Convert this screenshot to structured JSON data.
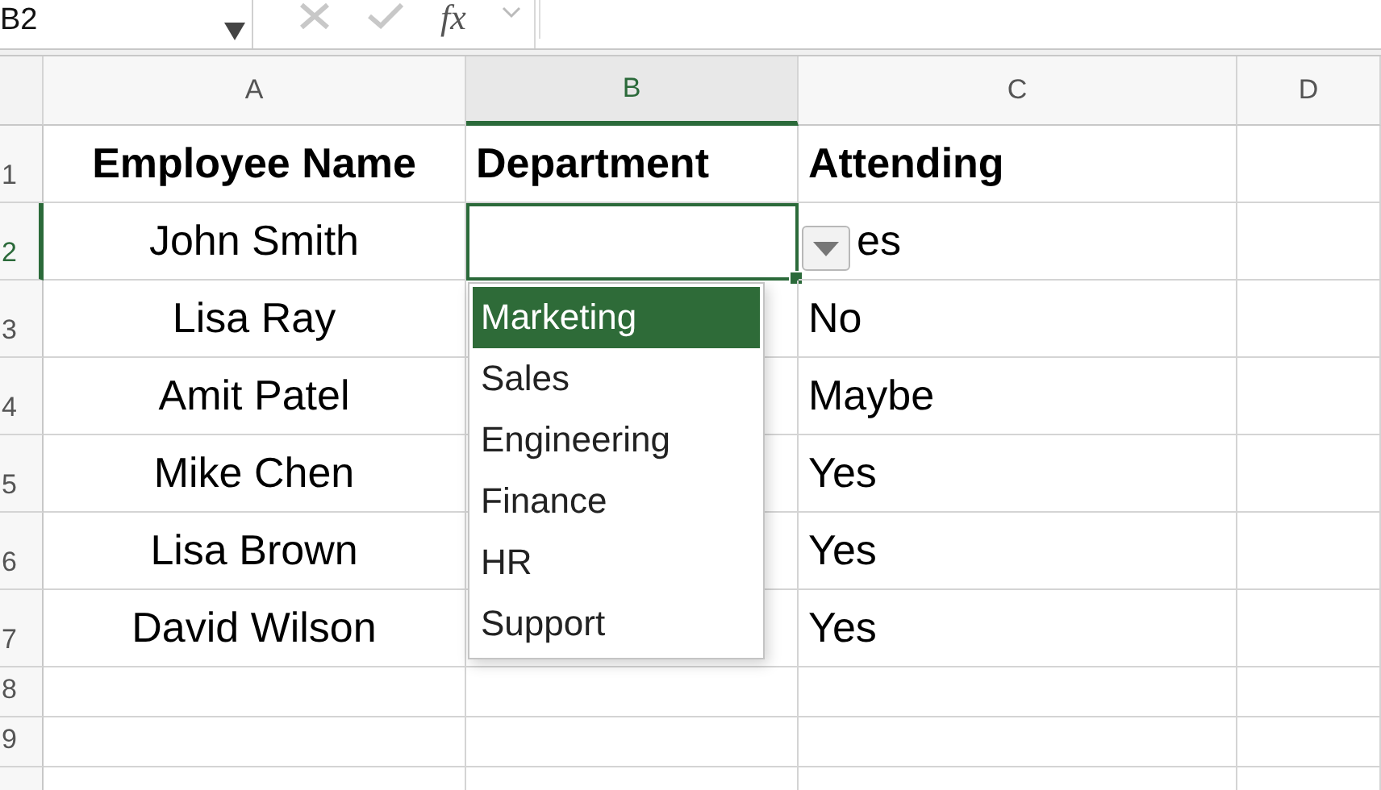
{
  "name_box": {
    "value": "B2"
  },
  "function_button": {
    "label": "fx"
  },
  "columns": [
    {
      "label": "A",
      "selected": false
    },
    {
      "label": "B",
      "selected": true
    },
    {
      "label": "C",
      "selected": false
    },
    {
      "label": "D",
      "selected": false
    }
  ],
  "rows": [
    {
      "label": "1",
      "selected": false,
      "kind": "header",
      "cells": [
        {
          "text": "Employee Name",
          "selected": false
        },
        {
          "text": "Department",
          "selected": false
        },
        {
          "text": "Attending",
          "selected": false
        }
      ]
    },
    {
      "label": "2",
      "selected": true,
      "kind": "data",
      "cells": [
        {
          "text": "John Smith",
          "selected": false
        },
        {
          "selected": true
        },
        {
          "text": "es",
          "selected": false
        }
      ]
    },
    {
      "label": "3",
      "selected": false,
      "kind": "data",
      "cells": [
        {
          "text": "Lisa Ray",
          "selected": false
        },
        {
          "selected": false
        },
        {
          "text": "No",
          "selected": false
        }
      ]
    },
    {
      "label": "4",
      "selected": false,
      "kind": "data",
      "cells": [
        {
          "text": "Amit Patel",
          "selected": false
        },
        {
          "selected": false
        },
        {
          "text": "Maybe",
          "selected": false
        }
      ]
    },
    {
      "label": "5",
      "selected": false,
      "kind": "data",
      "cells": [
        {
          "text": "Mike Chen",
          "selected": false
        },
        {
          "selected": false
        },
        {
          "text": "Yes",
          "selected": false
        }
      ]
    },
    {
      "label": "6",
      "selected": false,
      "kind": "data",
      "cells": [
        {
          "text": "Lisa Brown",
          "selected": false
        },
        {
          "selected": false
        },
        {
          "text": "Yes",
          "selected": false
        }
      ]
    },
    {
      "label": "7",
      "selected": false,
      "kind": "data",
      "cells": [
        {
          "text": "David Wilson",
          "selected": false
        },
        {
          "selected": false
        },
        {
          "text": "Yes",
          "selected": false
        }
      ]
    },
    {
      "label": "8",
      "selected": false,
      "kind": "empty",
      "cells": []
    },
    {
      "label": "9",
      "selected": false,
      "kind": "empty",
      "cells": []
    }
  ],
  "dropdown": {
    "options": [
      {
        "label": "Marketing",
        "selected": true
      },
      {
        "label": "Sales",
        "selected": false
      },
      {
        "label": "Engineering",
        "selected": false
      },
      {
        "label": "Finance",
        "selected": false
      },
      {
        "label": "HR",
        "selected": false
      },
      {
        "label": "Support",
        "selected": false
      }
    ]
  }
}
